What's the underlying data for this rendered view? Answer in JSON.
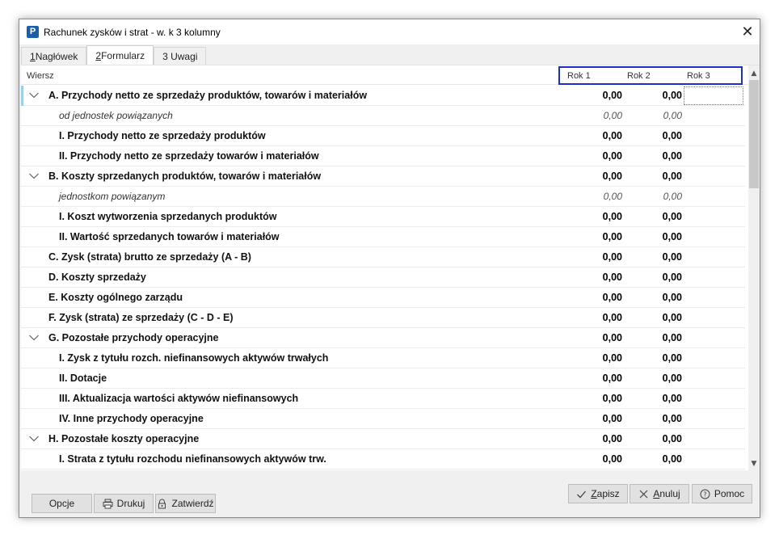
{
  "window": {
    "title": "Rachunek zysków i strat - w. k 3 kolumny",
    "app_icon_glyph": "P"
  },
  "tabs": [
    {
      "key": "1",
      "label": " Nagłówek"
    },
    {
      "key": "2",
      "label": " Formularz"
    },
    {
      "key": "",
      "label": "3 Uwagi"
    }
  ],
  "grid": {
    "row_header": "Wiersz",
    "columns": [
      "Rok 1",
      "Rok 2",
      "Rok 3"
    ],
    "rows": [
      {
        "label": "A. Przychody netto ze sprzedaży produktów, towarów i materiałów",
        "v1": "0,00",
        "v2": "0,00"
      },
      {
        "label": "od jednostek powiązanych",
        "v1": "0,00",
        "v2": "0,00"
      },
      {
        "label": "I. Przychody netto ze sprzedaży produktów",
        "v1": "0,00",
        "v2": "0,00"
      },
      {
        "label": "II. Przychody netto ze sprzedaży towarów i materiałów",
        "v1": "0,00",
        "v2": "0,00"
      },
      {
        "label": "B. Koszty sprzedanych produktów, towarów i materiałów",
        "v1": "0,00",
        "v2": "0,00"
      },
      {
        "label": "jednostkom powiązanym",
        "v1": "0,00",
        "v2": "0,00"
      },
      {
        "label": "I. Koszt wytworzenia sprzedanych produktów",
        "v1": "0,00",
        "v2": "0,00"
      },
      {
        "label": "II. Wartość sprzedanych towarów i materiałów",
        "v1": "0,00",
        "v2": "0,00"
      },
      {
        "label": "C. Zysk (strata) brutto ze sprzedaży (A - B)",
        "v1": "0,00",
        "v2": "0,00"
      },
      {
        "label": "D. Koszty sprzedaży",
        "v1": "0,00",
        "v2": "0,00"
      },
      {
        "label": "E. Koszty ogólnego zarządu",
        "v1": "0,00",
        "v2": "0,00"
      },
      {
        "label": "F. Zysk (strata) ze sprzedaży (C - D - E)",
        "v1": "0,00",
        "v2": "0,00"
      },
      {
        "label": "G. Pozostałe przychody operacyjne",
        "v1": "0,00",
        "v2": "0,00"
      },
      {
        "label": "I. Zysk z tytułu rozch. niefinansowych aktywów trwałych",
        "v1": "0,00",
        "v2": "0,00"
      },
      {
        "label": "II. Dotacje",
        "v1": "0,00",
        "v2": "0,00"
      },
      {
        "label": "III. Aktualizacja wartości aktywów niefinansowych",
        "v1": "0,00",
        "v2": "0,00"
      },
      {
        "label": "IV. Inne przychody operacyjne",
        "v1": "0,00",
        "v2": "0,00"
      },
      {
        "label": "H. Pozostałe koszty operacyjne",
        "v1": "0,00",
        "v2": "0,00"
      },
      {
        "label": "I. Strata z tytułu rozchodu niefinansowych aktywów trw.",
        "v1": "0,00",
        "v2": "0,00"
      }
    ]
  },
  "buttons": {
    "opcje": "Opcje",
    "drukuj": "Drukuj",
    "zatwierdz": "Zatwierdź",
    "zapisz_key": "Z",
    "zapisz_rest": "apisz",
    "anuluj_key": "A",
    "anuluj_rest": "nuluj",
    "pomoc": "Pomoc"
  },
  "colors": {
    "highlight_border": "#1c2fc9",
    "selection_marker": "#9bd0e6"
  }
}
